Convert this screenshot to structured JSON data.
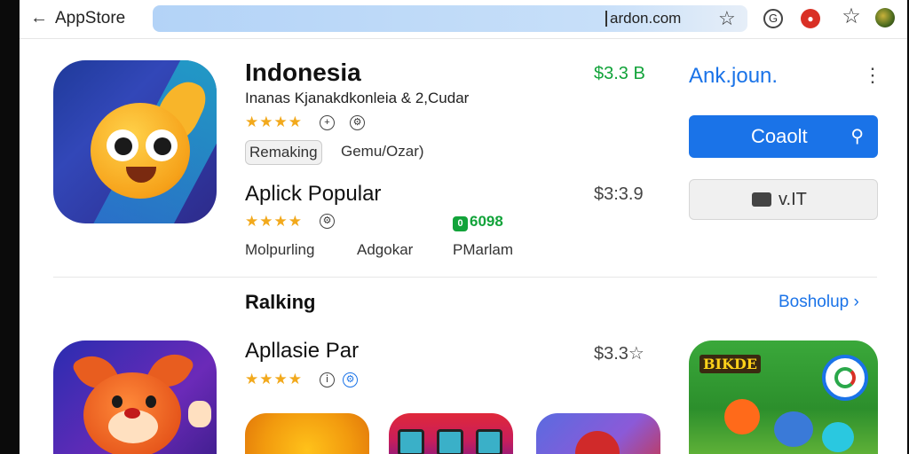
{
  "toolbar": {
    "title": "AppStore",
    "url": "ardon.com",
    "back_icon": "arrow-left-icon",
    "star_icon": "star-outline-icon"
  },
  "app1": {
    "name": "Indonesia",
    "subtitle": "Inanas Kjanakdkonleia & 2,Cudar",
    "rating": "★★★★",
    "tag": "Remaking",
    "tag2": "Gemu/Ozar)",
    "price": "$3.3 B",
    "price_color": "#12a33a"
  },
  "app2": {
    "name": "Aplick Popular",
    "rating": "★★★★",
    "badge": "6098",
    "badge_prefix": "0",
    "meta": [
      "Molpurling",
      "Adgokar",
      "PMarlam"
    ],
    "price": "$3:3.9"
  },
  "side": {
    "link": "Ank.joun.",
    "primary_button": "Coaolt",
    "secondary_button": "v.IT"
  },
  "section": {
    "title": "Ralking",
    "link": "Bosholup ›"
  },
  "app3": {
    "name": "Apllasie Par",
    "rating": "★★★★",
    "price": "$3.3☆",
    "game_title": "BIKDE"
  },
  "colors": {
    "accent": "#1a73e8",
    "star": "#f2a91c",
    "green": "#12a33a"
  }
}
